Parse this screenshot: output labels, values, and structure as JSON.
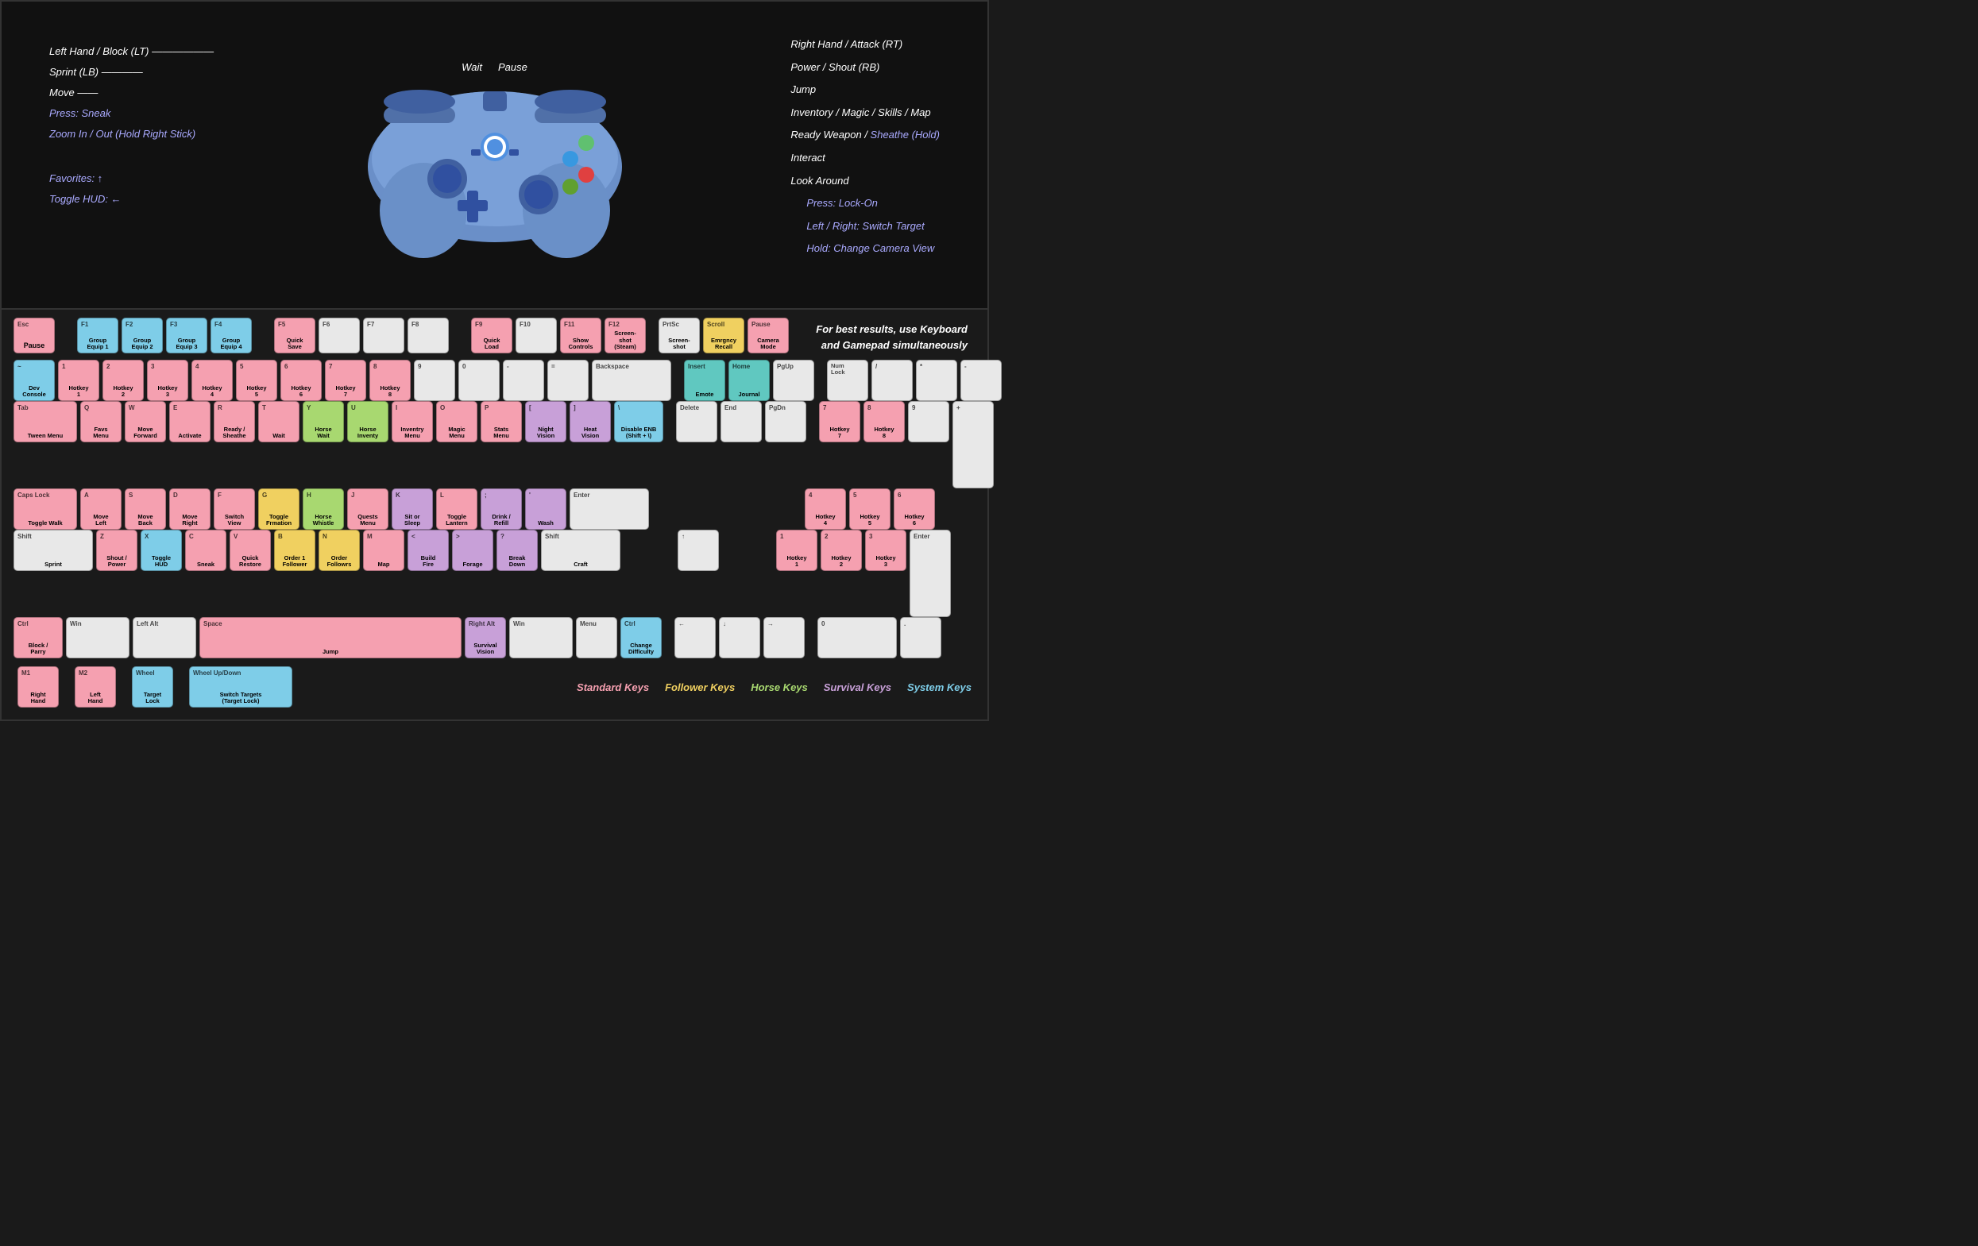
{
  "controller": {
    "labels_left": [
      {
        "text": "Left Hand / Block (LT)"
      },
      {
        "text": "Sprint (LB)"
      },
      {
        "text": "Move"
      },
      {
        "text": "Press: Sneak",
        "class": "sneak"
      },
      {
        "text": "Zoom In / Out (Hold Right Stick)",
        "class": "zoom"
      },
      {
        "text": "Favorites: ↑",
        "class": "favs"
      },
      {
        "text": "Toggle HUD: ←",
        "class": "hud"
      }
    ],
    "labels_center": [
      "Wait",
      "Pause"
    ],
    "labels_right": [
      {
        "text": "Right Hand / Attack (RT)"
      },
      {
        "text": "Power / Shout (RB)"
      },
      {
        "text": "Jump"
      },
      {
        "text": "Inventory / Magic / Skills / Map"
      },
      {
        "text": "Ready Weapon / Sheathe (Hold)"
      },
      {
        "text": "Interact"
      },
      {
        "text": "Look Around"
      },
      {
        "text": "Press: Lock-On",
        "class": "lock"
      },
      {
        "text": "Left / Right: Switch Target",
        "class": "switch"
      },
      {
        "text": "Hold: Change Camera View",
        "class": "change"
      }
    ]
  },
  "info": {
    "line1": "For best results, use Keyboard",
    "line2": "and Gamepad simultaneously"
  },
  "legend": {
    "standard": "Standard Keys",
    "follower": "Follower Keys",
    "horse": "Horse Keys",
    "survival": "Survival Keys",
    "system": "System Keys"
  },
  "keys": {
    "esc": {
      "top": "Esc",
      "label": "Pause"
    },
    "f1": {
      "top": "F1",
      "label": "Group\nEquip 1"
    },
    "f2": {
      "top": "F2",
      "label": "Group\nEquip 2"
    },
    "f3": {
      "top": "F3",
      "label": "Group\nEquip 3"
    },
    "f4": {
      "top": "F4",
      "label": "Group\nEquip 4"
    },
    "f5": {
      "top": "F5",
      "label": "Quick\nSave"
    },
    "f6": {
      "top": "F6",
      "label": ""
    },
    "f7": {
      "top": "F7",
      "label": ""
    },
    "f8": {
      "top": "F8",
      "label": ""
    },
    "f9": {
      "top": "F9",
      "label": "Quick\nLoad"
    },
    "f10": {
      "top": "F10",
      "label": ""
    },
    "f11": {
      "top": "F11",
      "label": "Show\nControls"
    },
    "f12": {
      "top": "F12",
      "label": "Screen-\nshot\n(Steam)"
    },
    "prtsc": {
      "top": "PrtSc",
      "label": "Screen-\nshot"
    },
    "scroll": {
      "top": "Scroll",
      "label": "Emrgncy\nRecall"
    },
    "pause": {
      "top": "Pause",
      "label": "Camera\nMode"
    },
    "tilde": {
      "top": "`",
      "label": "Dev\nConsole"
    },
    "1": {
      "top": "1",
      "label": "Hotkey\n1"
    },
    "2": {
      "top": "2",
      "label": "Hotkey\n2"
    },
    "3": {
      "top": "3",
      "label": "Hotkey\n3"
    },
    "4": {
      "top": "4",
      "label": "Hotkey\n4"
    },
    "5": {
      "top": "5",
      "label": "Hotkey\n5"
    },
    "6": {
      "top": "6",
      "label": "Hotkey\n6"
    },
    "7": {
      "top": "7",
      "label": "Hotkey\n7"
    },
    "8": {
      "top": "8",
      "label": "Hotkey\n8"
    },
    "9": {
      "top": "9",
      "label": ""
    },
    "0": {
      "top": "0",
      "label": ""
    },
    "minus": {
      "top": "-",
      "label": ""
    },
    "equals": {
      "top": "=",
      "label": ""
    },
    "backspace": {
      "top": "Backspace",
      "label": ""
    },
    "insert": {
      "top": "Insert",
      "label": "Emote"
    },
    "home": {
      "top": "Home",
      "label": "Journal"
    },
    "pgup": {
      "top": "PgUp",
      "label": ""
    },
    "tab": {
      "top": "Tab",
      "label": "Tween Menu"
    },
    "q": {
      "top": "Q",
      "label": "Favs\nMenu"
    },
    "w": {
      "top": "W",
      "label": "Move\nForward"
    },
    "e": {
      "top": "E",
      "label": "Activate"
    },
    "r": {
      "top": "R",
      "label": "Ready /\nSheathe"
    },
    "t": {
      "top": "T",
      "label": "Wait"
    },
    "y": {
      "top": "Y",
      "label": "Horse\nWait"
    },
    "u": {
      "top": "U",
      "label": "Horse\nInventy"
    },
    "i": {
      "top": "I",
      "label": "Inventry\nMenu"
    },
    "o": {
      "top": "O",
      "label": "Magic\nMenu"
    },
    "p": {
      "top": "P",
      "label": "Stats\nMenu"
    },
    "lbracket": {
      "top": "[",
      "label": "Night\nVision"
    },
    "rbracket": {
      "top": "]",
      "label": "Heat\nVision"
    },
    "backslash": {
      "top": "\\",
      "label": "Disable ENB\n(Shift + \\)"
    },
    "delete": {
      "top": "Delete",
      "label": ""
    },
    "end": {
      "top": "End",
      "label": ""
    },
    "pgdn": {
      "top": "PgDn",
      "label": ""
    },
    "num7": {
      "top": "7",
      "label": "Hotkey\n7"
    },
    "num8": {
      "top": "8",
      "label": "Hotkey\n8"
    },
    "num9": {
      "top": "9",
      "label": ""
    },
    "numplus": {
      "top": "+",
      "label": ""
    },
    "capslock": {
      "top": "Caps Lock",
      "label": "Toggle Walk"
    },
    "a": {
      "top": "A",
      "label": "Move\nLeft"
    },
    "s": {
      "top": "S",
      "label": "Move\nBack"
    },
    "d": {
      "top": "D",
      "label": "Move\nRight"
    },
    "f": {
      "top": "F",
      "label": "Switch\nView"
    },
    "g": {
      "top": "G",
      "label": "Toggle\nFrmation"
    },
    "h": {
      "top": "H",
      "label": "Horse\nWhistle"
    },
    "j": {
      "top": "J",
      "label": "Quests\nMenu"
    },
    "k": {
      "top": "K",
      "label": "Sit or\nSleep"
    },
    "l": {
      "top": "L",
      "label": "Toggle\nLantern"
    },
    "semicolon": {
      "top": ";",
      "label": "Drink /\nRefill"
    },
    "quote": {
      "top": "'",
      "label": "Wash"
    },
    "enter": {
      "top": "Enter",
      "label": ""
    },
    "num4": {
      "top": "4",
      "label": "Hotkey\n4"
    },
    "num5": {
      "top": "5",
      "label": "Hotkey\n5"
    },
    "num6": {
      "top": "6",
      "label": "Hotkey\n6"
    },
    "shift": {
      "top": "Shift",
      "label": "Sprint"
    },
    "z": {
      "top": "Z",
      "label": "Shout /\nPower"
    },
    "x": {
      "top": "X",
      "label": "Toggle\nHUD"
    },
    "c": {
      "top": "C",
      "label": "Sneak"
    },
    "v": {
      "top": "V",
      "label": "Quick\nRestore"
    },
    "b": {
      "top": "B",
      "label": "Order 1\nFollower"
    },
    "n": {
      "top": "N",
      "label": "Order\nFollowrs"
    },
    "m": {
      "top": "M",
      "label": "Map"
    },
    "comma": {
      "top": "<",
      "label": "Build\nFire"
    },
    "period": {
      "top": ">",
      "label": "Forage"
    },
    "slash": {
      "top": "?",
      "label": "Break\nDown"
    },
    "rshift": {
      "top": "Shift",
      "label": "Craft"
    },
    "uparrow": {
      "top": "↑",
      "label": ""
    },
    "num1": {
      "top": "1",
      "label": "Hotkey\n1"
    },
    "num2": {
      "top": "2",
      "label": "Hotkey\n2"
    },
    "num3": {
      "top": "3",
      "label": "Hotkey\n3"
    },
    "numenter": {
      "top": "Enter",
      "label": ""
    },
    "ctrl": {
      "top": "Ctrl",
      "label": "Block /\nParry"
    },
    "win": {
      "top": "Win",
      "label": ""
    },
    "lalt": {
      "top": "Left Alt",
      "label": ""
    },
    "space": {
      "top": "Space",
      "label": "Jump"
    },
    "ralt": {
      "top": "Right Alt",
      "label": "Survival\nVision"
    },
    "rwin": {
      "top": "Win",
      "label": ""
    },
    "menu": {
      "top": "Menu",
      "label": ""
    },
    "rctrl": {
      "top": "Ctrl",
      "label": "Change\nDifficulty"
    },
    "leftarrow": {
      "top": "←",
      "label": ""
    },
    "downarrow": {
      "top": "↓",
      "label": ""
    },
    "rightarrow": {
      "top": "→",
      "label": ""
    },
    "num0": {
      "top": "0",
      "label": ""
    },
    "numdot": {
      "top": ".",
      "label": ""
    },
    "numlock": {
      "top": "Num\nLock",
      "label": ""
    },
    "numslash": {
      "top": "/",
      "label": ""
    },
    "numstar": {
      "top": "*",
      "label": ""
    },
    "numminus": {
      "top": "-",
      "label": ""
    },
    "m1": {
      "top": "M1",
      "label": "Right\nHand"
    },
    "m2": {
      "top": "M2",
      "label": "Left\nHand"
    },
    "wheel": {
      "top": "Wheel",
      "label": "Target\nLock"
    },
    "wheelud": {
      "top": "Wheel Up/Down",
      "label": "Switch Targets\n(Target Lock)"
    }
  }
}
